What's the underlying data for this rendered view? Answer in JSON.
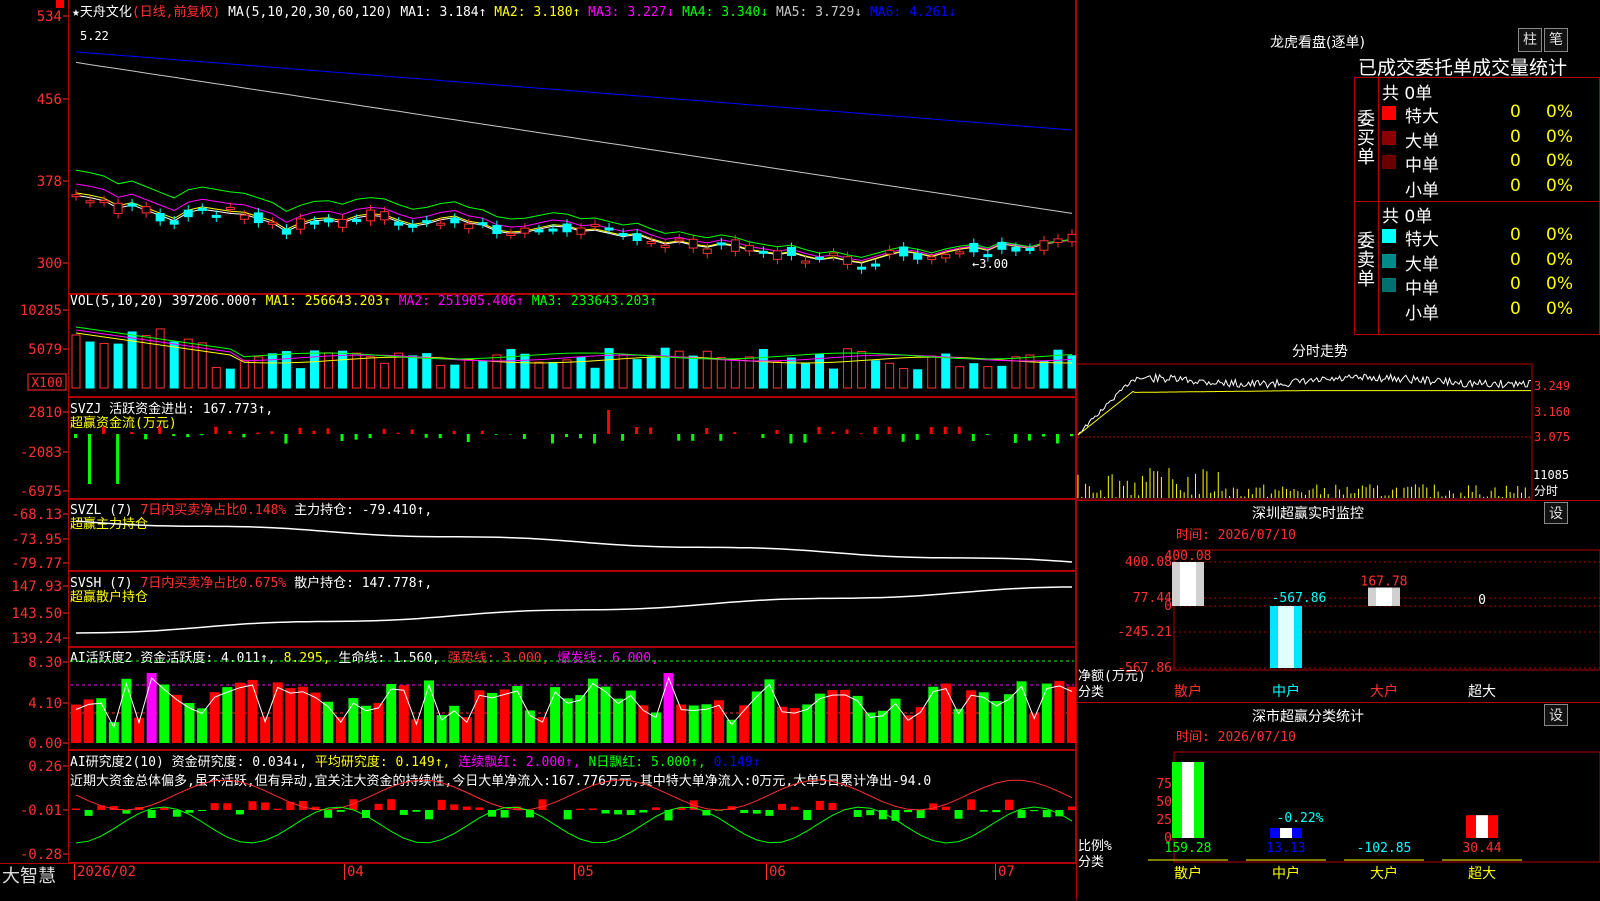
{
  "main": {
    "stock_name": "★天舟文化",
    "period": "(日线,前复权)",
    "ma_label": "MA(5,10,20,30,60,120)",
    "ma": [
      {
        "label": "MA1:",
        "value": "3.184↑",
        "color": "#ffffff"
      },
      {
        "label": "MA2:",
        "value": "3.180↑",
        "color": "#ffff00"
      },
      {
        "label": "MA3:",
        "value": "3.227↓",
        "color": "#ff00ff"
      },
      {
        "label": "MA4:",
        "value": "3.340↓",
        "color": "#00ff00"
      },
      {
        "label": "MA5:",
        "value": "3.729↓",
        "color": "#c8c8c8"
      },
      {
        "label": "MA6:",
        "value": "4.261↓",
        "color": "#0000ff"
      }
    ],
    "y_ticks": [
      "534",
      "456",
      "378",
      "300"
    ],
    "high_label": "5.22",
    "low_label": "←3.00",
    "candles": [
      3.64,
      3.62,
      3.59,
      3.52,
      3.55,
      3.5,
      3.45,
      3.4,
      3.48,
      3.51,
      3.49,
      3.47,
      3.46,
      3.42,
      3.38,
      3.3,
      3.36,
      3.4,
      3.41,
      3.38,
      3.43,
      3.45,
      3.44,
      3.39,
      3.35,
      3.37,
      3.41,
      3.43,
      3.38,
      3.36,
      3.3,
      3.28,
      3.29,
      3.32,
      3.35,
      3.34,
      3.3,
      3.31,
      3.28,
      3.25,
      3.27,
      3.22,
      3.18,
      3.2,
      3.17,
      3.15,
      3.18,
      3.16,
      3.12,
      3.1,
      3.08,
      3.1,
      3.06,
      3.03,
      3.05,
      3.02,
      3.0,
      3.04,
      3.08,
      3.11,
      3.09,
      3.06,
      3.1,
      3.13,
      3.15,
      3.12,
      3.18,
      3.16,
      3.14,
      3.18,
      3.2,
      3.22
    ]
  },
  "vol": {
    "header": "VOL(5,10,20)",
    "value": "397206.000↑",
    "ma1": "MA1: 256643.203↑",
    "ma2": "MA2: 251905.406↑",
    "ma3": "MA3: 233643.203↑",
    "y_ticks": [
      "10285",
      "5079"
    ],
    "unit": "X100"
  },
  "svzj": {
    "header": "SVZJ",
    "value": "活跃资金进出: 167.773↑,",
    "sub": "超赢资金流(万元)",
    "y_ticks": [
      "2810",
      "-2083",
      "-6975"
    ]
  },
  "svzl": {
    "header": "SVZL (7)",
    "red": "7日内买卖净占比0.148%",
    "white": "主力持仓: -79.410↑,",
    "sub": "超赢主力持仓",
    "y_ticks": [
      "-68.13",
      "-73.95",
      "-79.77"
    ]
  },
  "svsh": {
    "header": "SVSH (7)",
    "red": "7日内买卖净占比0.675%",
    "white": "散户持仓: 147.778↑,",
    "sub": "超赢散户持仓",
    "y_ticks": [
      "147.93",
      "143.50",
      "139.24"
    ]
  },
  "ai1": {
    "header": "AI活跃度2",
    "a": "资金活跃度: 4.011↑,",
    "b": "8.295,",
    "c": "生命线: 1.560,",
    "d": "强势线: 3.000,",
    "e": "爆发线: 6.000,",
    "y_ticks": [
      "8.30",
      "4.10",
      "0.00"
    ]
  },
  "ai2": {
    "header": "AI研究度2(10)",
    "a": "资金研究度: 0.034↓,",
    "b": "平均研究度: 0.149↑,",
    "c": "连续飘红: 2.000↑,",
    "d": "N日飘红: 5.000↑,",
    "e": "0.149↑",
    "summary": "近期大资金总体偏多,虽不活跃,但有异动,宜关注大资金的持续性,今日大单净流入:167.776万元,其中特大单净流入:0万元,大单5日累计净出-94.0",
    "y_ticks": [
      "0.26",
      "-0.01",
      "-0.28"
    ]
  },
  "bottom": {
    "brand": "大智慧",
    "dates": [
      "2026/02",
      "04",
      "05",
      "06",
      "07"
    ]
  },
  "right": {
    "lhb_title": "龙虎看盘(逐单)",
    "btn_col": "柱",
    "btn_pen": "笔",
    "header": "已成交委托单成交量统计",
    "buy_label": "委买单",
    "sell_label": "委卖单",
    "buy_total": "共 0单",
    "sell_total": "共 0单",
    "buy_rows": [
      {
        "name": "特大",
        "qty": "0",
        "pct": "0%",
        "color": "#ff0000"
      },
      {
        "name": "大单",
        "qty": "0",
        "pct": "0%",
        "color": "#8b0000"
      },
      {
        "name": "中单",
        "qty": "0",
        "pct": "0%",
        "color": "#6b0000"
      },
      {
        "name": "小单",
        "qty": "0",
        "pct": "0%",
        "color": "#000000"
      }
    ],
    "sell_rows": [
      {
        "name": "特大",
        "qty": "0",
        "pct": "0%",
        "color": "#00ffff"
      },
      {
        "name": "大单",
        "qty": "0",
        "pct": "0%",
        "color": "#008b8b"
      },
      {
        "name": "中单",
        "qty": "0",
        "pct": "0%",
        "color": "#007070"
      },
      {
        "name": "小单",
        "qty": "0",
        "pct": "0%",
        "color": "#000000"
      }
    ],
    "intraday_title": "分时走势",
    "intraday_ticks": [
      "3.249",
      "3.160",
      "3.075"
    ],
    "intraday_vol": "11085",
    "intraday_unit": "分时",
    "sz_title": "深圳超赢实时监控",
    "sz_btn": "设",
    "sz_time": "时间: 2026/07/10",
    "sz_ticks": [
      "400.08",
      "77.44",
      "0",
      "-245.21",
      "-567.86"
    ],
    "sz_ylabel1": "净额(万元)",
    "sz_ylabel2": "分类",
    "sz_bars": [
      {
        "cat": "散户",
        "value": 400.08,
        "label": "400.08",
        "cat_color": "#ff3030",
        "label_color": "#ff3030"
      },
      {
        "cat": "中户",
        "value": -567.86,
        "label": "-567.86",
        "cat_color": "#00ffff",
        "label_color": "#00ffff"
      },
      {
        "cat": "大户",
        "value": 167.78,
        "label": "167.78",
        "cat_color": "#ff3030",
        "label_color": "#ff3030"
      },
      {
        "cat": "超大",
        "value": 0,
        "label": "0",
        "cat_color": "#ffffff",
        "label_color": "#ffffff"
      }
    ],
    "ss_title": "深市超赢分类统计",
    "ss_btn": "设",
    "ss_time": "时间: 2026/07/10",
    "ss_ticks": [
      "75",
      "50",
      "25",
      "0"
    ],
    "ss_ylabel1": "比例%",
    "ss_ylabel2": "分类",
    "ss_bars": [
      {
        "cat": "散户",
        "value": 159.28,
        "label": "159.28",
        "pct": 100,
        "cat_color": "#ffff00",
        "label_color": "#00ff00",
        "bar": "#00ff00"
      },
      {
        "cat": "中户",
        "value": 13.13,
        "label": "13.13",
        "pct": -0.22,
        "cat_color": "#ffff00",
        "label_color": "#0000ff",
        "bar": "#0000ff",
        "pct_label": "-0.22%"
      },
      {
        "cat": "大户",
        "value": -102.85,
        "label": "-102.85",
        "pct": 0,
        "cat_color": "#ffff00",
        "label_color": "#00ffff",
        "bar": "#00ffff"
      },
      {
        "cat": "超大",
        "value": 30.44,
        "label": "30.44",
        "pct": 30,
        "cat_color": "#ffff00",
        "label_color": "#ff3030",
        "bar": "#ff0000"
      }
    ]
  }
}
